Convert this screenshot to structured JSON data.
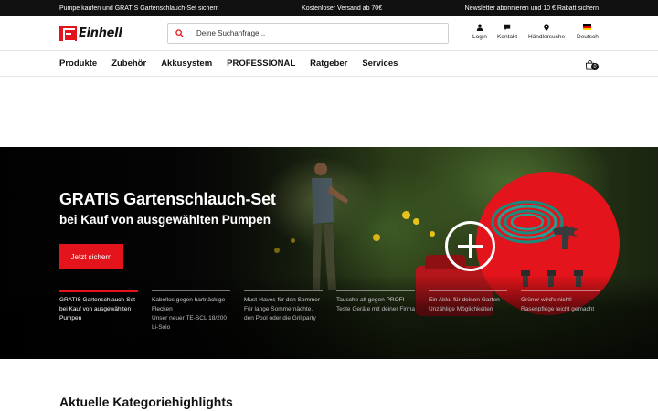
{
  "topbar": {
    "left": "Pumpe kaufen und GRATIS Gartenschlauch-Set sichern",
    "center": "Kostenloser Versand ab 70€",
    "right": "Newsletter abonnieren und 10 € Rabatt sichern"
  },
  "header": {
    "logo_text": "Einhell",
    "search_placeholder": "Deine Suchanfrage...",
    "icons": {
      "login": "Login",
      "contact": "Kontakt",
      "dealer": "Händlersuche",
      "language": "Deutsch"
    }
  },
  "nav": {
    "items": [
      "Produkte",
      "Zubehör",
      "Akkusystem",
      "PROFESSIONAL",
      "Ratgeber",
      "Services"
    ],
    "cart_count": "0"
  },
  "hero": {
    "title": "GRATIS Gartenschlauch-Set",
    "subtitle": "bei Kauf von ausgewählten Pumpen",
    "button": "Jetzt sichern",
    "slides": [
      {
        "title": "GRATIS Gartenschlauch-Set bei Kauf von ausgewählten Pumpen",
        "desc": ""
      },
      {
        "title": "Kabellos gegen hartnäckige Flecken",
        "desc": "Unser neuer TE-SCL 18/200 Li-Solo"
      },
      {
        "title": "Must-Haves für den Sommer",
        "desc": "Für lange Sommernächte, den Pool oder die Grillparty"
      },
      {
        "title": "Tausche alt gegen PROFI",
        "desc": "Teste Geräte mit deiner Firma"
      },
      {
        "title": "Ein Akku für deinen Garten",
        "desc": "Unzählige Möglichkeiten"
      },
      {
        "title": "Grüner wird's nicht!",
        "desc": "Rasenpflege leicht gemacht"
      }
    ]
  },
  "section": {
    "title": "Aktuelle Kategoriehighlights"
  },
  "colors": {
    "brand_red": "#e3141b",
    "topbar_bg": "#111111"
  }
}
